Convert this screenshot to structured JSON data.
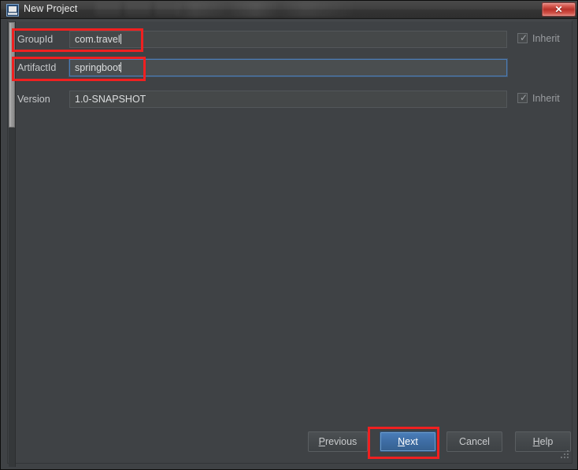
{
  "window": {
    "title": "New Project",
    "app_icon": "intellij-idea-icon",
    "close_label": "✕"
  },
  "form": {
    "rows": [
      {
        "label": "GroupId",
        "value": "com.travel",
        "focused": false,
        "inherit_label": "Inherit",
        "inherit_checked": true,
        "highlighted": true
      },
      {
        "label": "ArtifactId",
        "value": "springboot",
        "focused": true,
        "inherit_label": "",
        "inherit_checked": false,
        "highlighted": true
      },
      {
        "label": "Version",
        "value": "1.0-SNAPSHOT",
        "focused": false,
        "inherit_label": "Inherit",
        "inherit_checked": true,
        "highlighted": false
      }
    ],
    "checkbox_glyph": "✓"
  },
  "footer": {
    "previous": {
      "prefix": "",
      "mnemonic": "P",
      "suffix": "revious"
    },
    "next": {
      "prefix": "",
      "mnemonic": "N",
      "suffix": "ext"
    },
    "cancel": {
      "prefix": "Cancel",
      "mnemonic": "",
      "suffix": ""
    },
    "help": {
      "prefix": "",
      "mnemonic": "H",
      "suffix": "elp"
    }
  },
  "colors": {
    "panel_bg": "#3f4245",
    "field_bg": "#454849",
    "focus_border": "#4b7cb5",
    "default_button": "#3f6ea6",
    "annotation_red": "#f02020",
    "close_red": "#b9322a",
    "text": "#dcdedf"
  }
}
